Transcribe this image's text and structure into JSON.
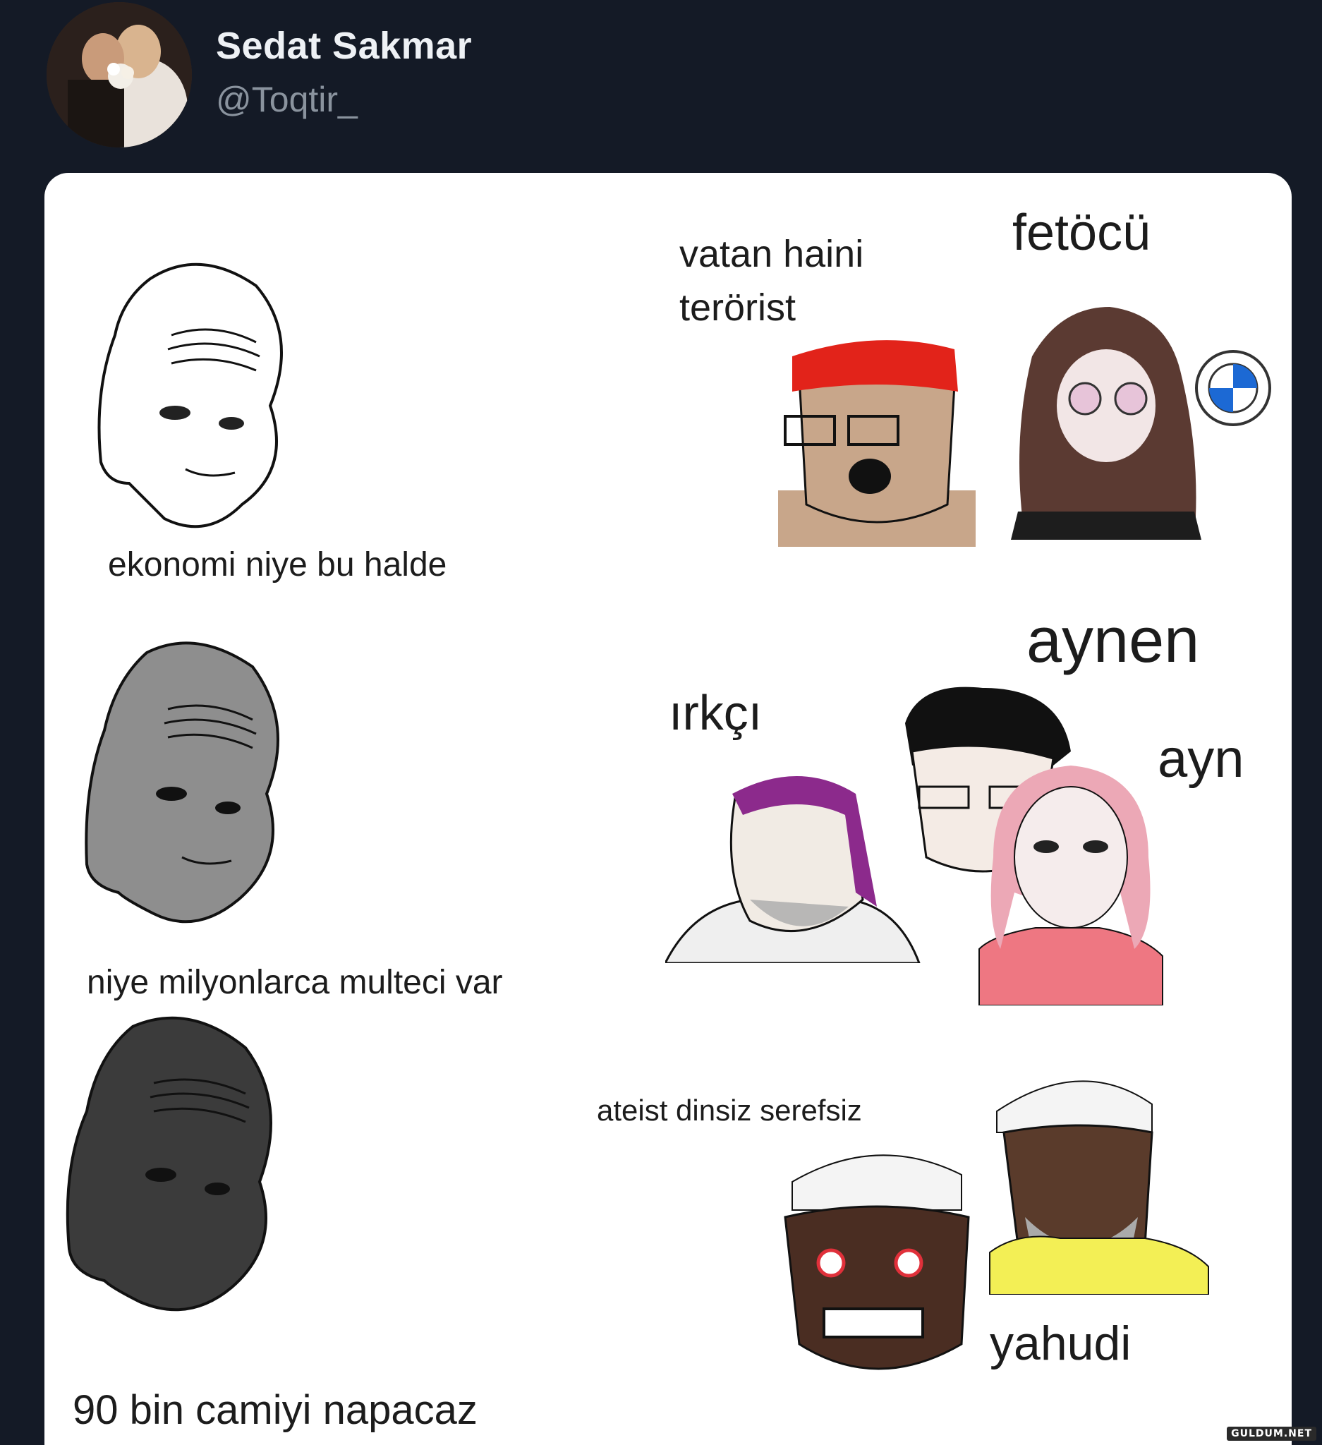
{
  "tweet": {
    "author_name": "Sedat Sakmar",
    "author_handle": "@Toqtir_"
  },
  "meme": {
    "rows": [
      {
        "left_caption": "ekonomi niye bu halde",
        "right_labels": [
          "vatan haini",
          "terörist",
          "fetöcü"
        ],
        "logo": "BMW"
      },
      {
        "left_caption": "niye milyonlarca multeci var",
        "right_labels": [
          "ırkçı",
          "aynen",
          "ayn"
        ]
      },
      {
        "left_caption": "90 bin camiyi napacaz",
        "right_labels": [
          "ateist dinsiz serefsiz",
          "yahudi"
        ]
      }
    ]
  },
  "watermark": "GULDUM.NET",
  "colors": {
    "background": "#141a26",
    "card": "#ffffff",
    "name": "#eef1f5",
    "handle": "#8a939e"
  }
}
